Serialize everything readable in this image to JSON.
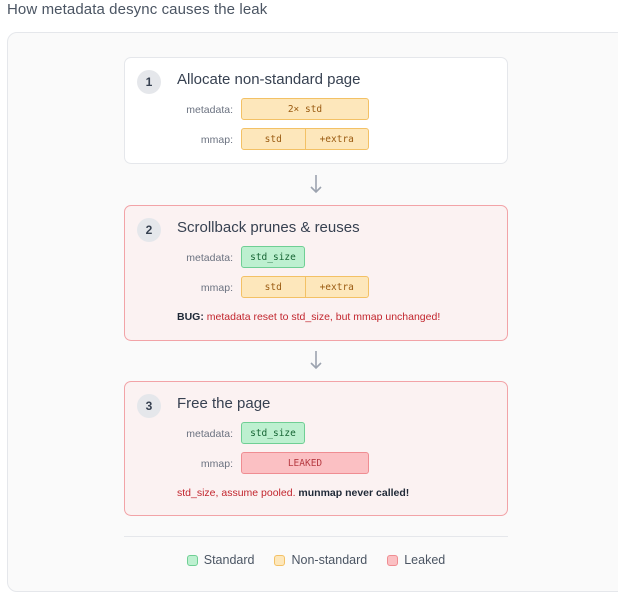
{
  "title": "How metadata desync causes the leak",
  "steps": [
    {
      "number": "1",
      "title": "Allocate non-standard page",
      "metadata_label": "metadata:",
      "metadata_bar": "2× std",
      "mmap_label": "mmap:",
      "mmap_segments": [
        "std",
        "+extra"
      ]
    },
    {
      "number": "2",
      "title": "Scrollback prunes & reuses",
      "metadata_label": "metadata:",
      "metadata_bar": "std_size",
      "mmap_label": "mmap:",
      "mmap_segments": [
        "std",
        "+extra"
      ],
      "note_bold": "BUG:",
      "note_text": " metadata reset to std_size, but mmap unchanged!"
    },
    {
      "number": "3",
      "title": "Free the page",
      "metadata_label": "metadata:",
      "metadata_bar": "std_size",
      "mmap_label": "mmap:",
      "mmap_bar": "LEAKED",
      "note_text": "std_size, assume pooled. ",
      "note_bold": "munmap never called!"
    }
  ],
  "legend": {
    "standard": "Standard",
    "non_standard": "Non-standard",
    "leaked": "Leaked"
  },
  "colors": {
    "standard": "#bdf0d0",
    "non_standard": "#fde7bb",
    "leaked": "#fbc0c3",
    "bug_text": "#c2262e",
    "arrow": "#9ca3af"
  }
}
